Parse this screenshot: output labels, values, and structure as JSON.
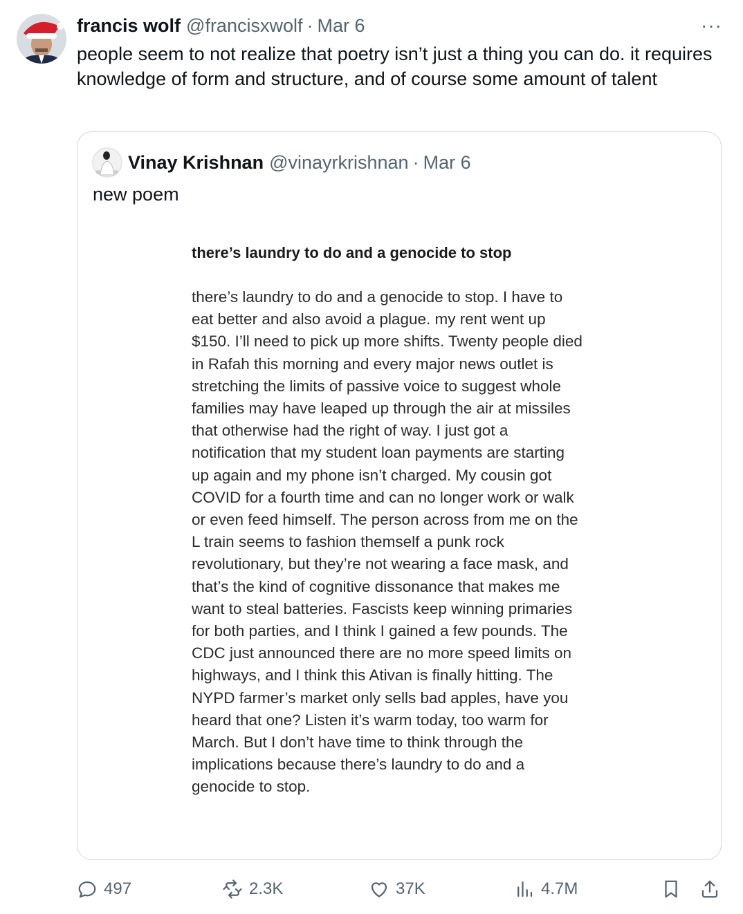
{
  "tweet": {
    "author_name": "francis wolf",
    "handle": "@francisxwolf",
    "separator": "·",
    "date": "Mar 6",
    "more_label": "···",
    "text": "people seem to not realize that poetry isn’t just a thing you can do. it requires knowledge of form and structure, and of course some amount of talent"
  },
  "quoted_tweet": {
    "author_name": "Vinay Krishnan",
    "handle": "@vinayrkrishnan",
    "separator": "·",
    "date": "Mar 6",
    "text": "new poem",
    "image": {
      "poem_title": "there’s laundry to do and a genocide to stop",
      "poem_lines": [
        "there’s laundry to do and a genocide to stop. I have to",
        "eat better and also avoid a plague. my rent went up",
        "$150. I’ll need to pick up more shifts. Twenty people died",
        "in Rafah this morning and every major news outlet is",
        "stretching the limits of passive voice to suggest whole",
        "families may have leaped up through the air at missiles",
        "that otherwise had the right of way. I just got a",
        "notification that my student loan payments are starting",
        "up again and my phone isn’t charged. My cousin got",
        "COVID for a fourth time and can no longer work or walk",
        "or even feed himself. The person across from me on the",
        "L train seems to fashion themself a punk rock",
        "revolutionary, but they’re not wearing a face mask, and",
        "that’s the kind of cognitive dissonance that makes me",
        "want to steal batteries. Fascists keep winning primaries",
        "for both parties, and I think I gained a few pounds. The",
        "CDC just announced there are no more speed limits on",
        "highways, and I think this Ativan is finally hitting. The",
        "NYPD farmer’s market only sells bad apples, have you",
        "heard that one? Listen it’s warm today, too warm for",
        "March. But I don’t have time to think through the",
        "implications because there’s laundry to do and a",
        "genocide to stop."
      ]
    }
  },
  "actions": {
    "reply_count": "497",
    "repost_count": "2.3K",
    "like_count": "37K",
    "view_count": "4.7M"
  },
  "colors": {
    "text_primary": "#0f1419",
    "text_secondary": "#536471",
    "border": "#cfd9de"
  }
}
